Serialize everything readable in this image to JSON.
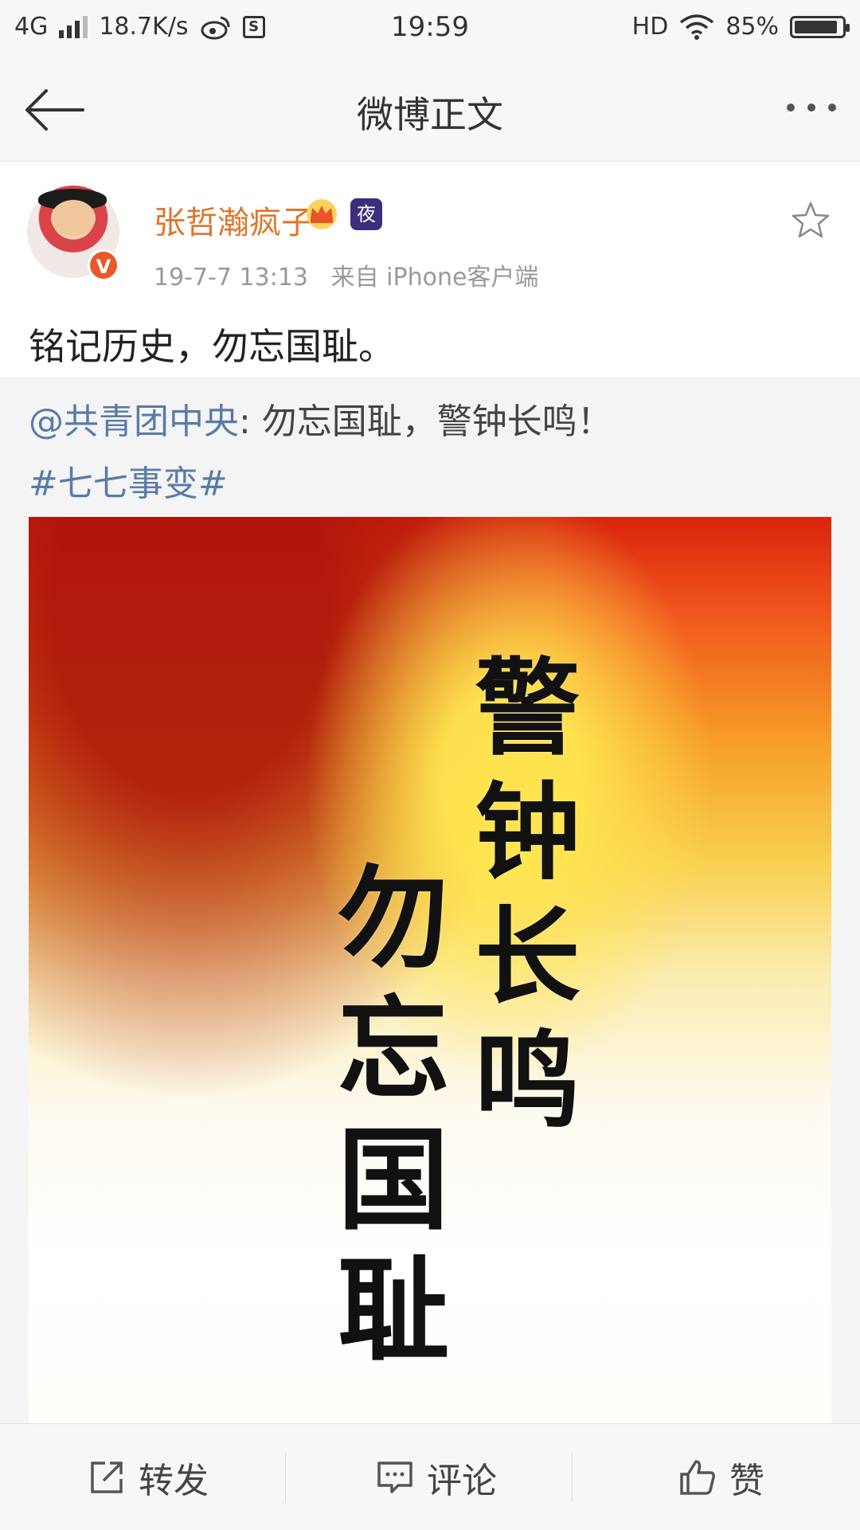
{
  "status_bar": {
    "network": "4G",
    "speed": "18.7K/s",
    "time": "19:59",
    "hd": "HD",
    "battery": "85%"
  },
  "header": {
    "title": "微博正文"
  },
  "post": {
    "username": "张哲瀚疯子",
    "night_badge": "夜",
    "verified_badge": "V",
    "timestamp": "19-7-7 13:13",
    "source": "来自 iPhone客户端",
    "text": "铭记历史，勿忘国耻。"
  },
  "repost": {
    "mention": "@共青团中央",
    "text": ": 勿忘国耻，警钟长鸣！",
    "hashtag": "#七七事变#",
    "image_text_right": "警钟长鸣",
    "image_text_left": "勿忘国耻"
  },
  "actions": {
    "forward": "转发",
    "comment": "评论",
    "like": "赞"
  },
  "colors": {
    "username": "#e0752b",
    "link": "#5a7ba7",
    "badge": "#e8592a"
  },
  "icons": [
    "back-arrow-icon",
    "more-icon",
    "crown-icon",
    "night-icon",
    "star-icon",
    "forward-icon",
    "comment-icon",
    "like-icon",
    "weibo-icon"
  ]
}
